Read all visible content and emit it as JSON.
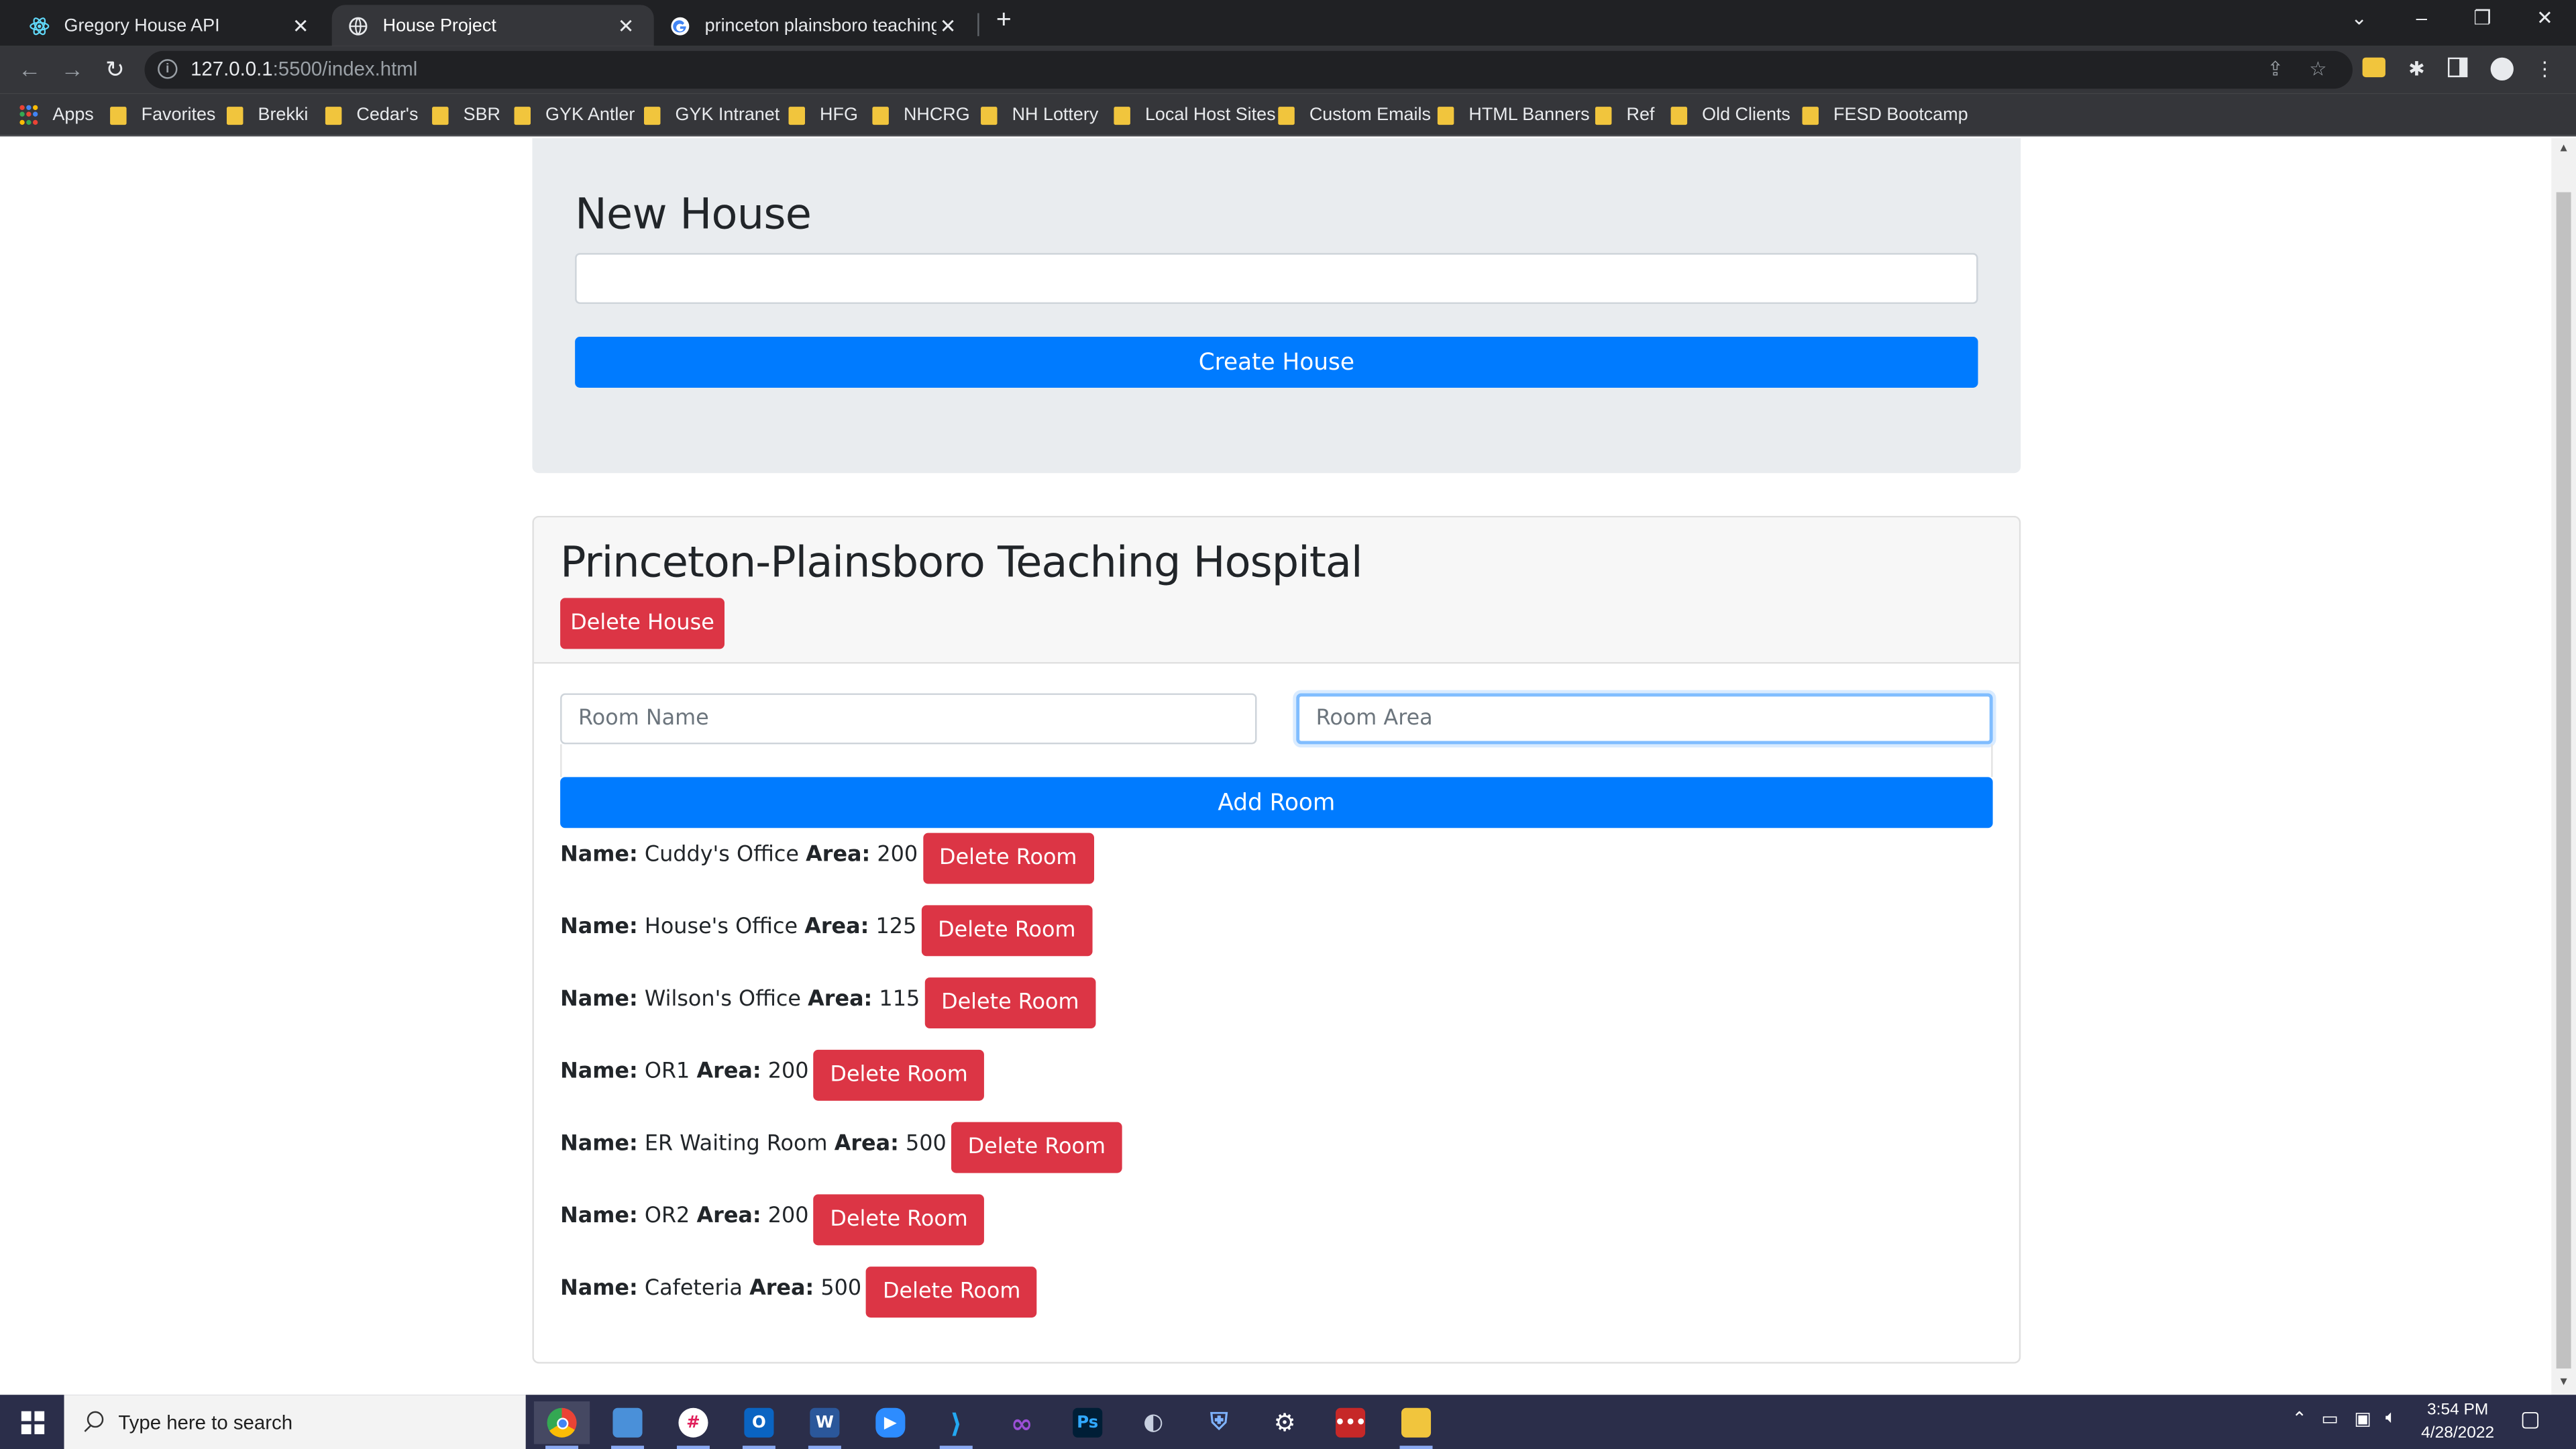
{
  "browser": {
    "tabs": [
      {
        "title": "Gregory House API",
        "active": false
      },
      {
        "title": "House Project",
        "active": true
      },
      {
        "title": "princeton plainsboro teaching ho",
        "active": false
      }
    ],
    "url_host": "127.0.0.1",
    "url_rest": ":5500/index.html",
    "bookmarks": [
      "Apps",
      "Favorites",
      "Brekki",
      "Cedar's",
      "SBR",
      "GYK Antler",
      "GYK Intranet",
      "HFG",
      "NHCRG",
      "NH Lottery",
      "Local Host Sites",
      "Custom Emails",
      "HTML Banners",
      "Ref",
      "Old Clients",
      "FESD Bootcamp"
    ]
  },
  "page": {
    "new_house_heading": "New House",
    "new_house_value": "",
    "create_house_label": "Create House",
    "house": {
      "name": "Princeton-Plainsboro Teaching Hospital",
      "delete_label": "Delete House",
      "room_name_placeholder": "Room Name",
      "room_area_placeholder": "Room Area",
      "add_room_label": "Add Room",
      "name_label": "Name:",
      "area_label": "Area:",
      "delete_room_label": "Delete Room",
      "rooms": [
        {
          "name": "Cuddy's Office",
          "area": "200"
        },
        {
          "name": "House's Office",
          "area": "125"
        },
        {
          "name": "Wilson's Office",
          "area": "115"
        },
        {
          "name": "OR1",
          "area": "200"
        },
        {
          "name": "ER Waiting Room",
          "area": "500"
        },
        {
          "name": "OR2",
          "area": "200"
        },
        {
          "name": "Cafeteria",
          "area": "500"
        }
      ]
    }
  },
  "taskbar": {
    "search_placeholder": "Type here to search",
    "time": "3:54 PM",
    "date": "4/28/2022"
  },
  "colors": {
    "primary": "#007bff",
    "danger": "#dc3545",
    "jumbotron": "#e9ecef",
    "chrome_dark": "#202124",
    "taskbar": "#2b2e4a"
  }
}
